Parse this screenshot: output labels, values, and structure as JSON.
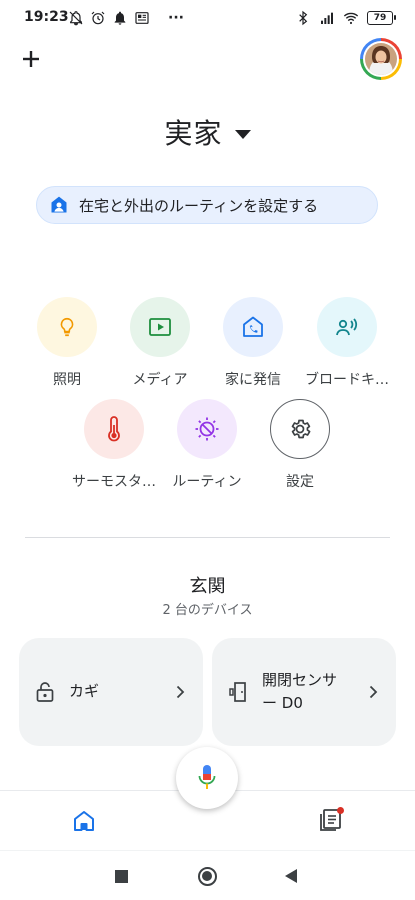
{
  "status_bar": {
    "time": "19:23",
    "more": "···",
    "battery": "79",
    "left_icons": [
      "notifications-off-icon",
      "alarm-icon",
      "bell-icon",
      "news-icon"
    ],
    "right_icons": [
      "bluetooth-icon",
      "signal-icon",
      "wifi-icon",
      "battery-icon"
    ]
  },
  "header": {
    "add_icon": "plus-icon",
    "home_name": "実家",
    "dropdown_icon": "caret-down-icon"
  },
  "routine_chip": {
    "label": "在宅と外出のルーティンを設定する",
    "icon": "home-person-icon"
  },
  "actions": [
    {
      "label": "照明",
      "icon": "lightbulb-icon",
      "bg": "#fef7e0",
      "color": "#f29900"
    },
    {
      "label": "メディア",
      "icon": "media-play-icon",
      "bg": "#e6f4ea",
      "color": "#1e8e3e"
    },
    {
      "label": "家に発信",
      "icon": "home-call-icon",
      "bg": "#e8f0fe",
      "color": "#1a73e8"
    },
    {
      "label": "ブロードキ…",
      "icon": "broadcast-icon",
      "bg": "#e4f7fb",
      "color": "#12858d"
    },
    {
      "label": "サーモスタ…",
      "icon": "thermostat-icon",
      "bg": "#fce8e6",
      "color": "#d93025"
    },
    {
      "label": "ルーティン",
      "icon": "routine-icon",
      "bg": "#f3e8fd",
      "color": "#9334e6"
    },
    {
      "label": "設定",
      "icon": "gear-icon",
      "bg": "#ffffff",
      "color": "#3c4043"
    }
  ],
  "room": {
    "name": "玄関",
    "device_count": "2 台のデバイス"
  },
  "devices": [
    {
      "label": "カギ",
      "icon": "lock-icon"
    },
    {
      "label_line1": "開閉センサ",
      "label_line2": "ー D0",
      "icon": "door-sensor-icon"
    }
  ],
  "mic": {
    "icon": "mic-icon"
  },
  "bottom_nav": {
    "tabs": [
      {
        "icon": "home-icon",
        "active": true
      },
      {
        "icon": "feed-icon",
        "active": false,
        "badge": true
      }
    ]
  }
}
